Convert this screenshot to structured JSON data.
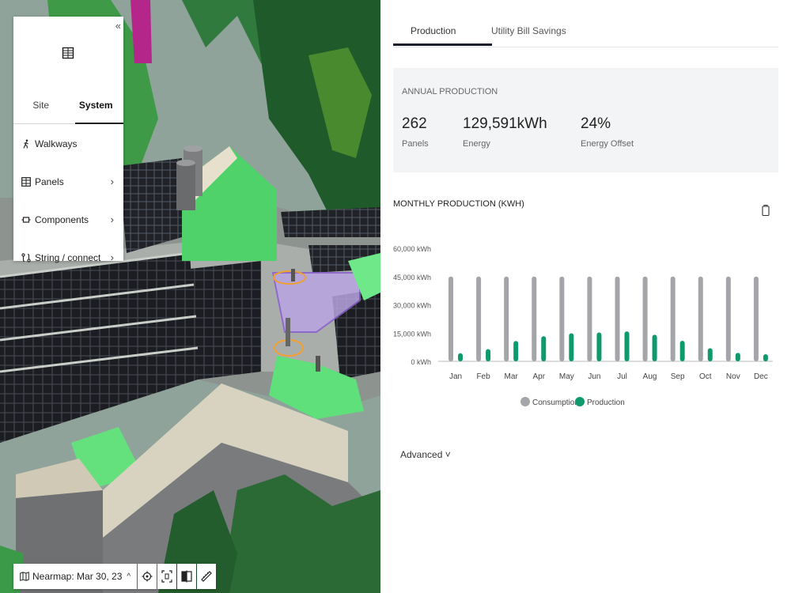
{
  "side_panel": {
    "collapse_icon": "«",
    "tabs": [
      {
        "label": "Site",
        "active": false
      },
      {
        "label": "System",
        "active": true
      }
    ],
    "items": [
      {
        "label": "Walkways",
        "icon": "walker-icon",
        "has_chevron": false
      },
      {
        "label": "Panels",
        "icon": "grid-icon",
        "has_chevron": true
      },
      {
        "label": "Components",
        "icon": "component-icon",
        "has_chevron": true
      },
      {
        "label": "String / connect",
        "icon": "string-icon",
        "has_chevron": true
      }
    ]
  },
  "bottom_bar": {
    "imagery_label": "Nearmap: Mar 30, 23",
    "imagery_expand": "^",
    "buttons": [
      "locate-icon",
      "fit-view-icon",
      "compare-icon",
      "ruler-icon"
    ]
  },
  "pane": {
    "tabs": [
      {
        "label": "Production",
        "active": true
      },
      {
        "label": "Utility Bill Savings",
        "active": false
      }
    ],
    "summary": {
      "heading": "ANNUAL PRODUCTION",
      "stats": [
        {
          "value": "262",
          "label": "Panels"
        },
        {
          "value": "129,591kWh",
          "label": "Energy"
        },
        {
          "value": "24%",
          "label": "Energy Offset"
        }
      ]
    },
    "monthly_title": "MONTHLY PRODUCTION (KWH)",
    "advanced_label": "Advanced ˅"
  },
  "colors": {
    "consumption": "#a3a5a8",
    "production": "#0f9a6e",
    "accent": "#1a1e2c"
  },
  "chart_data": {
    "type": "bar",
    "categories": [
      "Jan",
      "Feb",
      "Mar",
      "Apr",
      "May",
      "Jun",
      "Jul",
      "Aug",
      "Sep",
      "Oct",
      "Nov",
      "Dec"
    ],
    "series": [
      {
        "name": "Consumption",
        "values": [
          45000,
          45000,
          45000,
          45000,
          45000,
          45000,
          45000,
          45000,
          45000,
          45000,
          45000,
          45000
        ]
      },
      {
        "name": "Production",
        "values": [
          4300,
          6500,
          10800,
          13300,
          14900,
          15300,
          15900,
          14100,
          10900,
          7000,
          4500,
          3800
        ]
      }
    ],
    "yticks": [
      "0 kWh",
      "15,000 kWh",
      "30,000 kWh",
      "45,000 kWh",
      "60,000 kWh"
    ],
    "ylim": [
      0,
      60000
    ],
    "legend_position": "bottom-center"
  }
}
